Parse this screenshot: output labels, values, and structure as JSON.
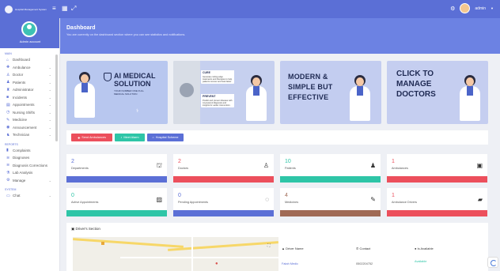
{
  "topbar": {
    "brand": "Hospital Management System",
    "user": "admin"
  },
  "sidebar": {
    "user_name": "Admin account",
    "sections": [
      {
        "title": "MAIN",
        "items": [
          {
            "label": "Dashboard",
            "icon": "home-icon"
          },
          {
            "label": "Ambulance",
            "icon": "ambulance-icon"
          },
          {
            "label": "Doctor",
            "icon": "doctor-icon"
          },
          {
            "label": "Patients",
            "icon": "patients-icon"
          },
          {
            "label": "Administrator",
            "icon": "admin-icon"
          },
          {
            "label": "Incidents",
            "icon": "incident-icon"
          },
          {
            "label": "Appointments",
            "icon": "calendar-icon"
          },
          {
            "label": "Nursing Shifts",
            "icon": "shift-icon"
          },
          {
            "label": "Medicine",
            "icon": "pill-icon"
          },
          {
            "label": "Announcement",
            "icon": "megaphone-icon"
          },
          {
            "label": "Technician",
            "icon": "technician-icon"
          }
        ]
      },
      {
        "title": "REPORTS",
        "items": [
          {
            "label": "Complaints",
            "icon": "complaint-icon"
          },
          {
            "label": "Diagnoses",
            "icon": "diagnose-icon"
          },
          {
            "label": "Diagnosis Corrections",
            "icon": "diagnose-icon"
          },
          {
            "label": "Lab Analysis",
            "icon": "lab-icon"
          },
          {
            "label": "Manage",
            "icon": "manage-icon"
          }
        ]
      },
      {
        "title": "SYSTEM",
        "items": [
          {
            "label": "Chat",
            "icon": "chat-icon"
          }
        ]
      }
    ]
  },
  "header": {
    "title": "Dashboard",
    "subtitle": "You are currently on the dashboard section where you can see statistics and notifications."
  },
  "banners": {
    "b1_title": "AI MEDICAL SOLUTION",
    "b1_sub": "YOUR NUMBER ONE FULL MEDICAL SOLUTION",
    "b2_cure": "CURE",
    "b2_cure_text": "Generate cutting-edge treatments and therapies to help patients recover and heal faster.",
    "b2_prevent": "PREVENT",
    "b2_prevent_text": "Predict and prevent disease with AI-powered diagnosis and insights for earlier intervention.",
    "b3_title": "MODERN & SIMPLE BUT EFFECTIVE",
    "b4_title": "CLICK TO MANAGE DOCTORS"
  },
  "actions": {
    "send_ambulance": "Send Ambulances",
    "meet_alarm": "Meet Alarm",
    "hospital_scheme": "Hospital Scheme"
  },
  "stats": [
    {
      "value": "2",
      "label": "Departments",
      "icon": "building-icon",
      "color": "#5b6fd6"
    },
    {
      "value": "2",
      "label": "Doctors",
      "icon": "doctor-icon",
      "color": "#ec4f5c"
    },
    {
      "value": "10",
      "label": "Patients",
      "icon": "group-icon",
      "color": "#2ec5a7"
    },
    {
      "value": "1",
      "label": "Ambulances",
      "icon": "ambulance-icon",
      "color": "#ec4f5c"
    },
    {
      "value": "0",
      "label": "Active Appointments",
      "icon": "calendar-check-icon",
      "color": "#2ec5a7"
    },
    {
      "value": "0",
      "label": "Pending Appointments",
      "icon": "spinner-icon",
      "color": "#5b6fd6"
    },
    {
      "value": "4",
      "label": "Medicines",
      "icon": "syringe-icon",
      "color": "#a06a55"
    },
    {
      "value": "1",
      "label": "Ambulance Drivers",
      "icon": "truck-icon",
      "color": "#ec4f5c"
    }
  ],
  "drivers": {
    "title": "Driver's Section",
    "col_name": "Driver Name",
    "col_contact": "Contact",
    "col_status": "Is Available",
    "rows": [
      {
        "name": "Fatah Medic",
        "contact": "0502204752",
        "status": "Available"
      }
    ]
  },
  "colors": {
    "brand": "#5b6fd6",
    "header": "#6c82e3",
    "red": "#ec4f5c",
    "green": "#2ec5a7",
    "brown": "#a06a55"
  }
}
